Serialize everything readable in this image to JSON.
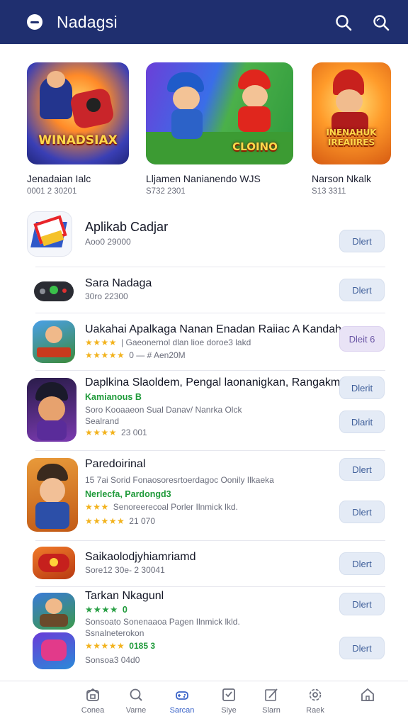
{
  "header": {
    "title": "Nadagsi",
    "icons": [
      "menu-icon",
      "search-icon",
      "search-alt-icon"
    ],
    "bg_color": "#1f2f6f"
  },
  "featured": [
    {
      "name": "Jenadaian Ialc",
      "sub": "0001 2 30201",
      "art_text": "WINADSIAX"
    },
    {
      "name": "Lljamen Nanianendo WJS",
      "sub": "S732 2301",
      "art_text": "CLOINO"
    },
    {
      "name": "Narson Nkalk",
      "sub": "S13 3311",
      "art_text": "INENAHUK IREAIIRES"
    }
  ],
  "list": [
    {
      "title": "Aplikab Cadjar",
      "line1": "Aoo0 29000",
      "button": "Dlert"
    },
    {
      "title": "Sara Nadaga",
      "line1": "30ro 22300",
      "button": "Dlert"
    },
    {
      "title": "Uakahai Apalkaga Nanan Enadan Raiiac A Kandah,",
      "line1": "| Gaeonernol dlan lioe doroe3 lakd",
      "rating": "0 — # Aen20M",
      "button": "Dleit 6"
    },
    {
      "title": "Daplkina Slaoldem, Pengal laonanigkan, Rangakmain!",
      "green": "Kamianous B",
      "line1": "Soro Kooaaeon Sual Danav/ Nanrka Olck",
      "line2": "Sealrand",
      "rating": "23 001",
      "buttons": [
        "Dlerit",
        "Dlarit"
      ]
    },
    {
      "title": "Paredoirinal",
      "line1": "15 7ai Sorid Fonaosoresrtoerdagoc Oonily Ilkaeka",
      "green": "Nerlecfa, Pardongd3",
      "line2": "Senoreerecoal Porler Ilnmick lkd.",
      "rating": "21 070",
      "buttons": [
        "Dlert",
        "Dlert"
      ]
    },
    {
      "title": "Saikaolodjyhiamriamd",
      "line1": "Sore12 30e- 2 30041",
      "button": "Dlert"
    },
    {
      "title": "Tarkan Nkagunl",
      "green": "0",
      "line1": "Sonsoato Sonenaaoa Pagen Ilnmick lkld.",
      "line2": "Ssnalneterokon",
      "rating": "0185 3",
      "line3": "Sonsoa3 04d0",
      "buttons": [
        "Dlert",
        "Dlert"
      ]
    }
  ],
  "bottom_nav": [
    {
      "label": "Conea",
      "icon": "home-box-icon"
    },
    {
      "label": "Varne",
      "icon": "search-icon"
    },
    {
      "label": "Sarcan",
      "icon": "gamepad-icon",
      "active": true
    },
    {
      "label": "Siye",
      "icon": "inbox-check-icon"
    },
    {
      "label": "Slarn",
      "icon": "pen-icon"
    },
    {
      "label": "Raek",
      "icon": "settings-icon"
    },
    {
      "label": "",
      "icon": "home-icon"
    }
  ],
  "colors": {
    "accent": "#3a63c8",
    "button_bg": "#e4ebf6",
    "green": "#1f9a3a",
    "star": "#f2b21c"
  }
}
